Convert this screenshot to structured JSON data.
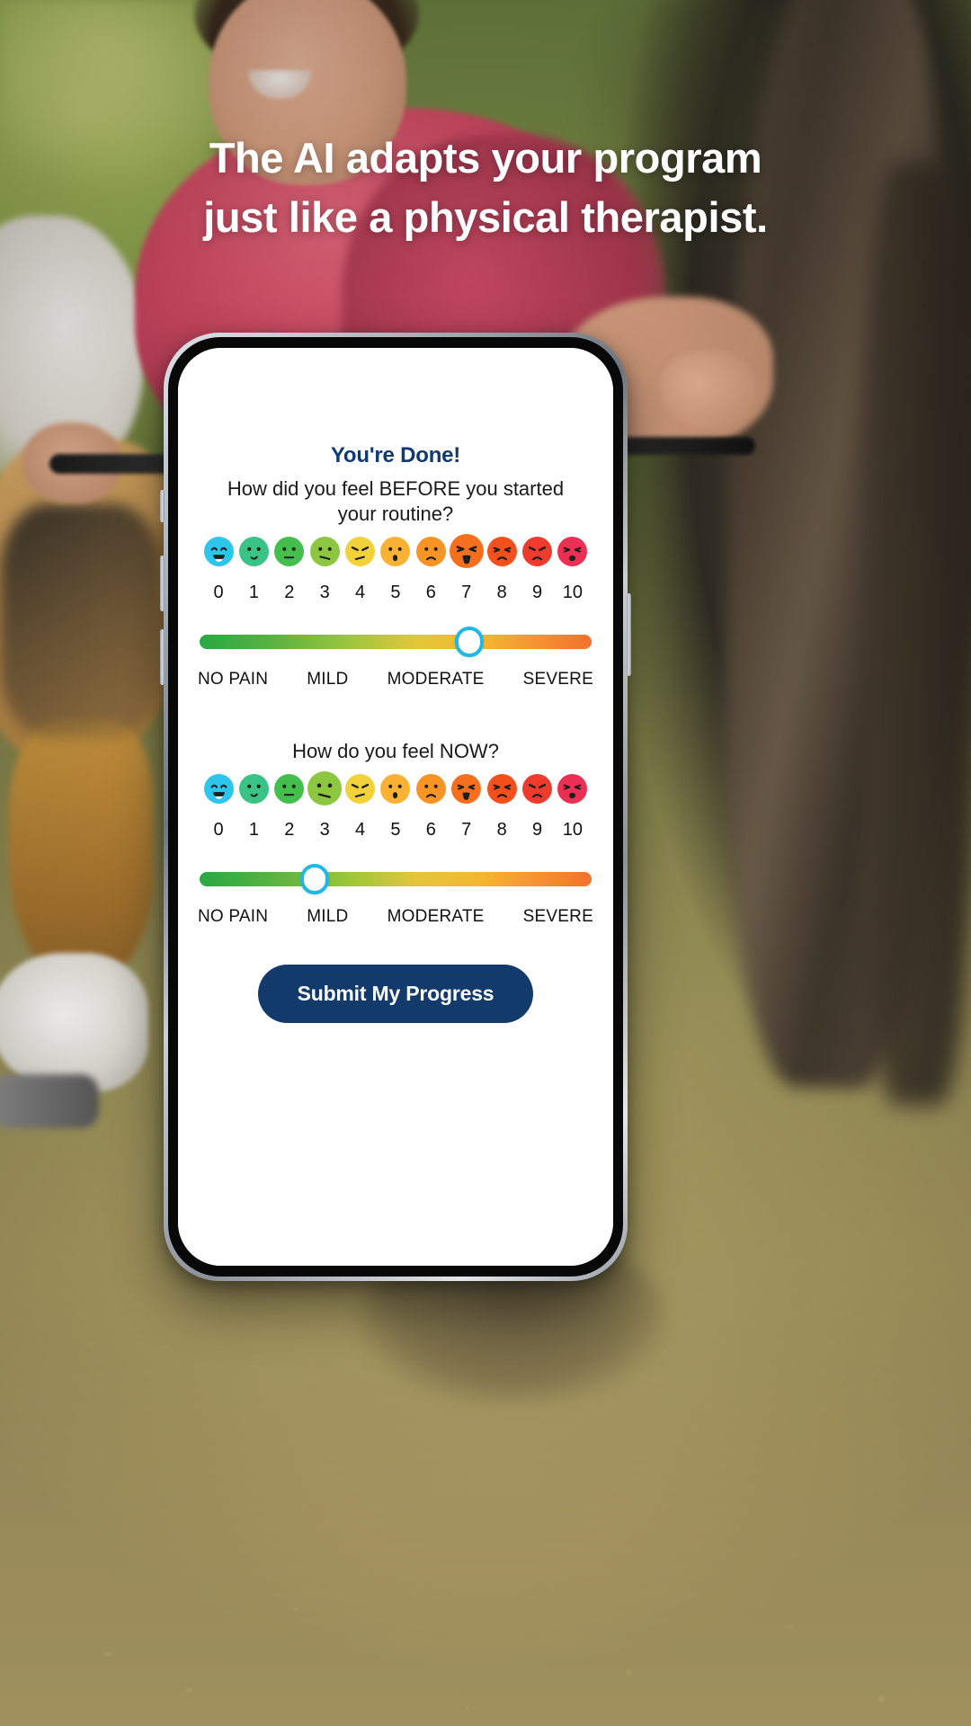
{
  "headline": {
    "line1": "The AI adapts your program",
    "line2": "just like a physical therapist."
  },
  "phone": {
    "screen": {
      "title": "You're Done!",
      "before": {
        "question_line1": "How did you feel BEFORE you started",
        "question_line2": "your routine?",
        "numbers": [
          "0",
          "1",
          "2",
          "3",
          "4",
          "5",
          "6",
          "7",
          "8",
          "9",
          "10"
        ],
        "selected_value": 7,
        "faces": [
          {
            "value": "0",
            "color": "#2ec5ea",
            "mouth": "big-smile",
            "eyes": "arc",
            "label": "laughing-face"
          },
          {
            "value": "1",
            "color": "#3bc285",
            "mouth": "slight-smile",
            "eyes": "dot",
            "label": "slight-smile-face"
          },
          {
            "value": "2",
            "color": "#44bf4d",
            "mouth": "flat",
            "eyes": "dot",
            "label": "neutral-face"
          },
          {
            "value": "3",
            "color": "#8dc73f",
            "mouth": "slant",
            "eyes": "dot",
            "label": "unsure-face"
          },
          {
            "value": "4",
            "color": "#f2d23b",
            "mouth": "frown-slant",
            "eyes": "angry",
            "label": "annoyed-face"
          },
          {
            "value": "5",
            "color": "#f9b233",
            "mouth": "oh",
            "eyes": "dot",
            "label": "surprised-face"
          },
          {
            "value": "6",
            "color": "#f79425",
            "mouth": "frown",
            "eyes": "dot",
            "label": "sad-face"
          },
          {
            "value": "7",
            "color": "#f4701f",
            "mouth": "open-wide",
            "eyes": "squint",
            "label": "distressed-face"
          },
          {
            "value": "8",
            "color": "#f2501d",
            "mouth": "frown",
            "eyes": "squint",
            "label": "hurting-face"
          },
          {
            "value": "9",
            "color": "#ef3b2e",
            "mouth": "frown",
            "eyes": "angry",
            "label": "pained-face"
          },
          {
            "value": "10",
            "color": "#ec2f55",
            "mouth": "grimace",
            "eyes": "squint",
            "label": "agony-face"
          }
        ],
        "scale_labels": [
          "NO PAIN",
          "MILD",
          "MODERATE",
          "SEVERE"
        ]
      },
      "now": {
        "question": "How do you feel NOW?",
        "numbers": [
          "0",
          "1",
          "2",
          "3",
          "4",
          "5",
          "6",
          "7",
          "8",
          "9",
          "10"
        ],
        "selected_value": 3,
        "faces": [
          {
            "value": "0",
            "color": "#2ec5ea",
            "mouth": "big-smile",
            "eyes": "arc",
            "label": "laughing-face"
          },
          {
            "value": "1",
            "color": "#3bc285",
            "mouth": "slight-smile",
            "eyes": "dot",
            "label": "slight-smile-face"
          },
          {
            "value": "2",
            "color": "#44bf4d",
            "mouth": "flat",
            "eyes": "dot",
            "label": "neutral-face"
          },
          {
            "value": "3",
            "color": "#8dc73f",
            "mouth": "slant",
            "eyes": "dot",
            "label": "unsure-face"
          },
          {
            "value": "4",
            "color": "#f2d23b",
            "mouth": "frown-slant",
            "eyes": "angry",
            "label": "annoyed-face"
          },
          {
            "value": "5",
            "color": "#f9b233",
            "mouth": "oh",
            "eyes": "dot",
            "label": "surprised-face"
          },
          {
            "value": "6",
            "color": "#f79425",
            "mouth": "frown",
            "eyes": "dot",
            "label": "sad-face"
          },
          {
            "value": "7",
            "color": "#f4701f",
            "mouth": "open-wide",
            "eyes": "squint",
            "label": "distressed-face"
          },
          {
            "value": "8",
            "color": "#f2501d",
            "mouth": "frown",
            "eyes": "squint",
            "label": "hurting-face"
          },
          {
            "value": "9",
            "color": "#ef3b2e",
            "mouth": "frown",
            "eyes": "angry",
            "label": "pained-face"
          },
          {
            "value": "10",
            "color": "#ec2f55",
            "mouth": "grimace",
            "eyes": "squint",
            "label": "agony-face"
          }
        ],
        "scale_labels": [
          "NO PAIN",
          "MILD",
          "MODERATE",
          "SEVERE"
        ]
      },
      "submit_label": "Submit My Progress"
    }
  },
  "colors": {
    "headline_text": "#ffffff",
    "title_navy": "#103a72",
    "button_navy": "#123a6b",
    "thumb_border_cyan": "#22b8e6"
  }
}
